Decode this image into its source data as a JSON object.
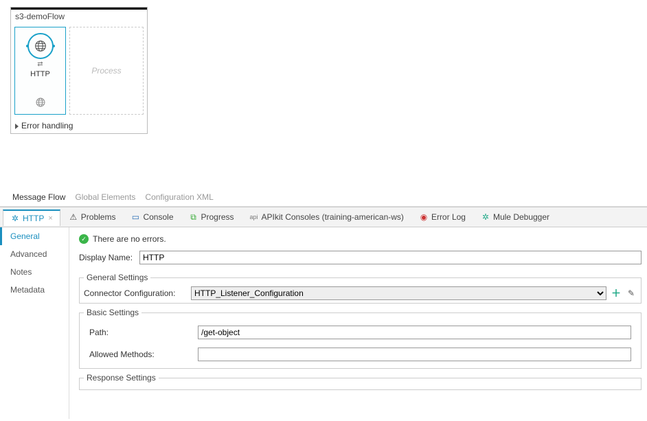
{
  "flow": {
    "name": "s3-demoFlow",
    "connector_label": "HTTP",
    "process_placeholder": "Process",
    "error_section": "Error handling"
  },
  "editor_tabs": {
    "t1": "Message Flow",
    "t2": "Global Elements",
    "t3": "Configuration XML"
  },
  "view_tabs": {
    "http": "HTTP",
    "problems": "Problems",
    "console": "Console",
    "progress": "Progress",
    "apikit": "APIkit Consoles (training-american-ws)",
    "errorlog": "Error Log",
    "mule": "Mule Debugger"
  },
  "sidebar": {
    "general": "General",
    "advanced": "Advanced",
    "notes": "Notes",
    "metadata": "Metadata"
  },
  "status": {
    "msg": "There are no errors."
  },
  "form": {
    "display_name_label": "Display Name:",
    "display_name_value": "HTTP",
    "general_legend": "General Settings",
    "connector_label": "Connector Configuration:",
    "connector_value": "HTTP_Listener_Configuration",
    "basic_legend": "Basic Settings",
    "path_label": "Path:",
    "path_value": "/get-object",
    "methods_label": "Allowed Methods:",
    "methods_value": "",
    "response_legend": "Response Settings"
  }
}
